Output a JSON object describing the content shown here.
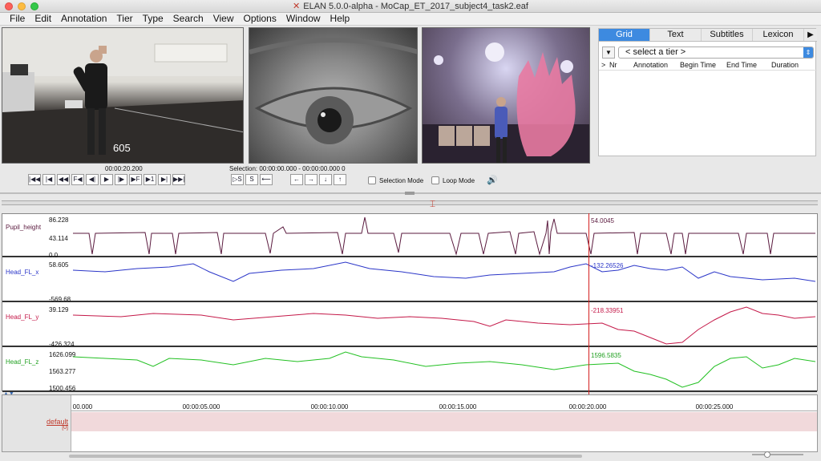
{
  "window": {
    "title": "ELAN 5.0.0-alpha - MoCap_ET_2017_subject4_task2.eaf"
  },
  "menu": [
    "File",
    "Edit",
    "Annotation",
    "Tier",
    "Type",
    "Search",
    "View",
    "Options",
    "Window",
    "Help"
  ],
  "video": {
    "overlay_counter": "605"
  },
  "grid_panel": {
    "tabs": [
      "Grid",
      "Text",
      "Subtitles",
      "Lexicon"
    ],
    "active_tab": "Grid",
    "tier_select_value": "< select a tier >",
    "columns": [
      ">",
      "Nr",
      "Annotation",
      "Begin Time",
      "End Time",
      "Duration"
    ]
  },
  "media": {
    "current_time": "00:00:20.200",
    "selection_label": "Selection: 00:00:00.000 - 00:00:00.000  0",
    "player_buttons": [
      "|◀◀",
      "|◀",
      "◀◀",
      "F◀",
      "◀|",
      "▶",
      "|▶",
      "▶F",
      "▶1",
      "▶|",
      "▶▶|"
    ],
    "selection_buttons": [
      "▷S",
      "S",
      "⟵"
    ],
    "nav_buttons": [
      "←",
      "→",
      "↓",
      "↑"
    ],
    "selection_mode_label": "Selection Mode",
    "loop_mode_label": "Loop Mode"
  },
  "timeseries": {
    "tracks": [
      {
        "name": "Pupil_height",
        "max": "86.228",
        "mid": "43.114",
        "min": "0.0",
        "cursor_value": "54.0045",
        "color": "#5a1a3e"
      },
      {
        "name": "Head_FL_x",
        "max": "58.605",
        "mid": "",
        "min": "-569.68",
        "cursor_value": "-132.26526",
        "color": "#2a35c8"
      },
      {
        "name": "Head_FL_y",
        "max": "39.129",
        "mid": "",
        "min": "-426.324",
        "cursor_value": "-218.33951",
        "color": "#c41848"
      },
      {
        "name": "Head_FL_z",
        "max": "1626.099",
        "mid": "1563.277",
        "min": "1500.456",
        "cursor_value": "1596.5835",
        "color": "#22c022"
      }
    ]
  },
  "timeline": {
    "ruler_labels": [
      "00.000",
      "00:00:05.000",
      "00:00:10.000",
      "00:00:15.000",
      "00:00:20.000",
      "00:00:25.000"
    ],
    "tier_name": "default",
    "tier_count": "[0]"
  }
}
